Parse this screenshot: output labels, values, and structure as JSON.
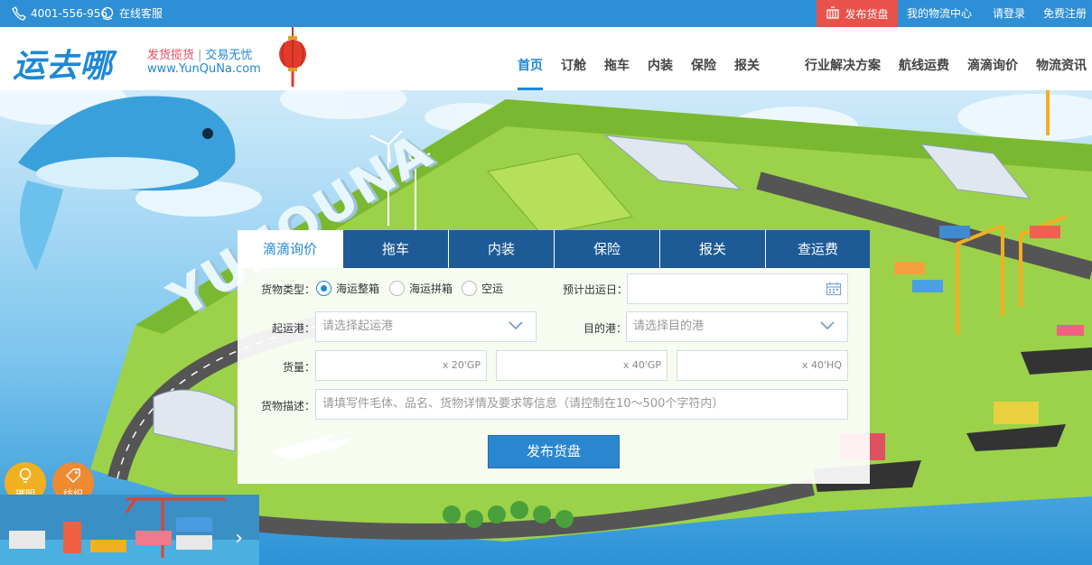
{
  "topbar": {
    "phone": "4001-556-956",
    "online_service": "在线客服",
    "publish_label": "发布货盘",
    "my_logistics": "我的物流中心",
    "login": "请登录",
    "register": "免费注册"
  },
  "header": {
    "logo_text": "运去哪",
    "slogan_1": "发货揽货",
    "slogan_sep": "|",
    "slogan_2": "交易无忧",
    "domain": "www.YunQuNa.com",
    "nav": [
      "首页",
      "订舱",
      "拖车",
      "内装",
      "保险",
      "报关"
    ],
    "nav_right": [
      "行业解决方案",
      "航线运费",
      "滴滴询价",
      "物流资讯"
    ],
    "active_nav": "首页"
  },
  "scene": {
    "brand_3d": "YUNQUNA"
  },
  "form": {
    "tabs": [
      "滴滴询价",
      "拖车",
      "内装",
      "保险",
      "报关",
      "查运费"
    ],
    "active_tab": "滴滴询价",
    "cargo_type_label": "货物类型：",
    "cargo_types": [
      "海运整箱",
      "海运拼箱",
      "空运"
    ],
    "selected_cargo_type": "海运整箱",
    "etd_label": "预计出运日：",
    "etd_value": "",
    "origin_label": "起运港：",
    "origin_placeholder": "请选择起运港",
    "dest_label": "目的港：",
    "dest_placeholder": "请选择目的港",
    "quantity_label": "货量：",
    "quantity_units": [
      "x 20'GP",
      "x 40'GP",
      "x 40'HQ"
    ],
    "description_label": "货物描述：",
    "description_placeholder": "请填写件毛体、品名、货物详情及要求等信息（请控制在10～500个字符内）",
    "submit_label": "发布货盘"
  },
  "side_badges": {
    "badge_1": "璀明",
    "badge_2": "纺织"
  },
  "colors": {
    "topbar_bg": "#2d8fd5",
    "publish_bg": "#e8524a",
    "brand_blue": "#1e88d6",
    "tab_bg": "#1d5a96",
    "submit_bg": "#2b86d0"
  }
}
